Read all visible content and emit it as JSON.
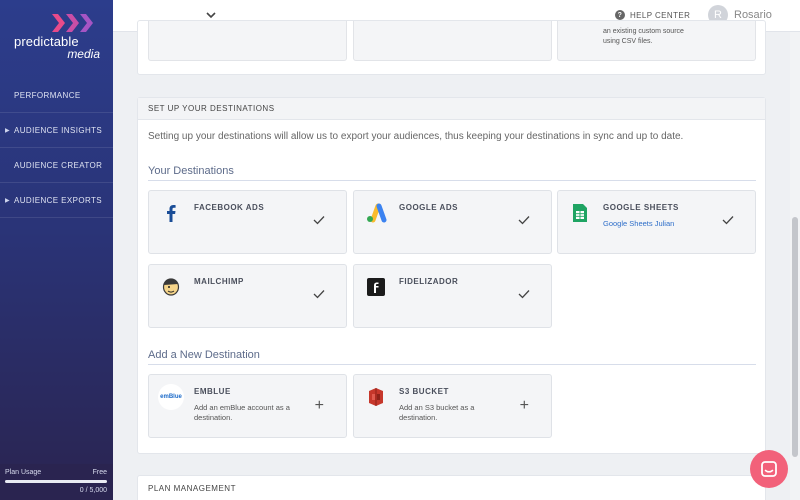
{
  "brand": {
    "name_line1": "predictable",
    "name_line2": "media"
  },
  "sidebar": {
    "items": [
      {
        "label": "PERFORMANCE",
        "expandable": false
      },
      {
        "label": "AUDIENCE INSIGHTS",
        "expandable": true
      },
      {
        "label": "AUDIENCE CREATOR",
        "expandable": false
      },
      {
        "label": "AUDIENCE EXPORTS",
        "expandable": true
      }
    ],
    "plan": {
      "label": "Plan Usage",
      "tier": "Free",
      "count": "0 / 5,000",
      "usage_fraction": 0.0
    }
  },
  "topbar": {
    "help_label": "HELP CENTER",
    "user_initial": "R",
    "user_name": "Rosario"
  },
  "top_section": {
    "text_line1": "an existing custom source",
    "text_line2": "using CSV files."
  },
  "destinations": {
    "header": "SET UP YOUR DESTINATIONS",
    "intro": "Setting up your destinations will allow us to export your audiences, thus keeping your destinations in sync and up to date.",
    "yours_title": "Your Destinations",
    "yours": [
      {
        "name": "FACEBOOK ADS",
        "icon": "facebook-icon",
        "sub": ""
      },
      {
        "name": "GOOGLE ADS",
        "icon": "google-ads-icon",
        "sub": ""
      },
      {
        "name": "GOOGLE SHEETS",
        "icon": "google-sheets-icon",
        "sub": "Google Sheets Julian"
      },
      {
        "name": "MAILCHIMP",
        "icon": "mailchimp-icon",
        "sub": ""
      },
      {
        "name": "FIDELIZADOR",
        "icon": "fidelizador-icon",
        "sub": ""
      }
    ],
    "add_title": "Add a New Destination",
    "available": [
      {
        "name": "EMBLUE",
        "icon": "emblue-icon",
        "logo_text": "emBlue",
        "desc": "Add an emBlue account as a destination."
      },
      {
        "name": "S3 BUCKET",
        "icon": "s3-bucket-icon",
        "desc": "Add an S3 bucket as a destination."
      }
    ]
  },
  "plan_management": {
    "header": "PLAN MANAGEMENT"
  },
  "colors": {
    "sidebar_top": "#2c3d8c",
    "sidebar_bottom": "#2a2450",
    "accent_pink": "#f2617a",
    "link_blue": "#2f6fc9"
  }
}
